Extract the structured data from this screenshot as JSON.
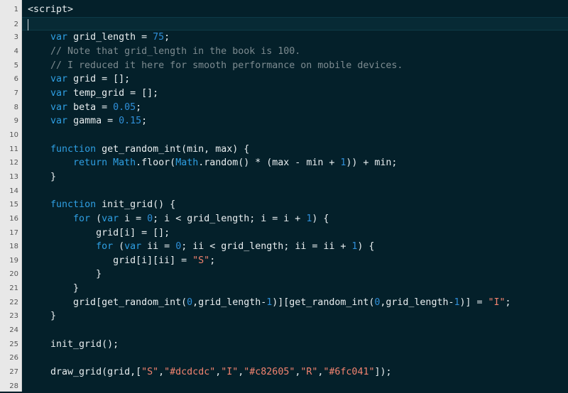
{
  "editor": {
    "active_line": 2,
    "colors": {
      "background": "#04202a",
      "keyword": "#2f9fe3",
      "number": "#2f8fd8",
      "string": "#f2836f",
      "comment": "#7d8b90",
      "plain": "#e9eef0",
      "gutter": "#e8e8e8"
    },
    "lines": [
      [
        [
          "p",
          "<script>"
        ]
      ],
      [],
      [
        [
          "p",
          "    "
        ],
        [
          "k",
          "var"
        ],
        [
          "p",
          " grid_length = "
        ],
        [
          "n",
          "75"
        ],
        [
          "p",
          ";"
        ]
      ],
      [
        [
          "c",
          "    // Note that grid_length in the book is 100."
        ]
      ],
      [
        [
          "c",
          "    // I reduced it here for smooth performance on mobile devices."
        ]
      ],
      [
        [
          "p",
          "    "
        ],
        [
          "k",
          "var"
        ],
        [
          "p",
          " grid = [];"
        ]
      ],
      [
        [
          "p",
          "    "
        ],
        [
          "k",
          "var"
        ],
        [
          "p",
          " temp_grid = [];"
        ]
      ],
      [
        [
          "p",
          "    "
        ],
        [
          "k",
          "var"
        ],
        [
          "p",
          " beta = "
        ],
        [
          "n",
          "0.05"
        ],
        [
          "p",
          ";"
        ]
      ],
      [
        [
          "p",
          "    "
        ],
        [
          "k",
          "var"
        ],
        [
          "p",
          " gamma = "
        ],
        [
          "n",
          "0.15"
        ],
        [
          "p",
          ";"
        ]
      ],
      [],
      [
        [
          "p",
          "    "
        ],
        [
          "k",
          "function"
        ],
        [
          "p",
          " get_random_int(min, max) {"
        ]
      ],
      [
        [
          "p",
          "        "
        ],
        [
          "k",
          "return"
        ],
        [
          "p",
          " "
        ],
        [
          "k",
          "Math"
        ],
        [
          "p",
          ".floor("
        ],
        [
          "k",
          "Math"
        ],
        [
          "p",
          ".random() * (max - min + "
        ],
        [
          "n",
          "1"
        ],
        [
          "p",
          ")) + min;"
        ]
      ],
      [
        [
          "p",
          "    }"
        ]
      ],
      [],
      [
        [
          "p",
          "    "
        ],
        [
          "k",
          "function"
        ],
        [
          "p",
          " init_grid() {"
        ]
      ],
      [
        [
          "p",
          "        "
        ],
        [
          "k",
          "for"
        ],
        [
          "p",
          " ("
        ],
        [
          "k",
          "var"
        ],
        [
          "p",
          " i = "
        ],
        [
          "n",
          "0"
        ],
        [
          "p",
          "; i < grid_length; i = i + "
        ],
        [
          "n",
          "1"
        ],
        [
          "p",
          ") {"
        ]
      ],
      [
        [
          "p",
          "            grid[i] = [];"
        ]
      ],
      [
        [
          "p",
          "            "
        ],
        [
          "k",
          "for"
        ],
        [
          "p",
          " ("
        ],
        [
          "k",
          "var"
        ],
        [
          "p",
          " ii = "
        ],
        [
          "n",
          "0"
        ],
        [
          "p",
          "; ii < grid_length; ii = ii + "
        ],
        [
          "n",
          "1"
        ],
        [
          "p",
          ") {"
        ]
      ],
      [
        [
          "p",
          "               grid[i][ii] = "
        ],
        [
          "s",
          "\"S\""
        ],
        [
          "p",
          ";"
        ]
      ],
      [
        [
          "p",
          "            }"
        ]
      ],
      [
        [
          "p",
          "        }"
        ]
      ],
      [
        [
          "p",
          "        grid[get_random_int("
        ],
        [
          "n",
          "0"
        ],
        [
          "p",
          ",grid_length-"
        ],
        [
          "n",
          "1"
        ],
        [
          "p",
          ")][get_random_int("
        ],
        [
          "n",
          "0"
        ],
        [
          "p",
          ",grid_length-"
        ],
        [
          "n",
          "1"
        ],
        [
          "p",
          ")] = "
        ],
        [
          "s",
          "\"I\""
        ],
        [
          "p",
          ";"
        ]
      ],
      [
        [
          "p",
          "    }"
        ]
      ],
      [],
      [
        [
          "p",
          "    init_grid();"
        ]
      ],
      [],
      [
        [
          "p",
          "    draw_grid(grid,["
        ],
        [
          "s",
          "\"S\""
        ],
        [
          "p",
          ","
        ],
        [
          "s",
          "\"#dcdcdc\""
        ],
        [
          "p",
          ","
        ],
        [
          "s",
          "\"I\""
        ],
        [
          "p",
          ","
        ],
        [
          "s",
          "\"#c82605\""
        ],
        [
          "p",
          ","
        ],
        [
          "s",
          "\"R\""
        ],
        [
          "p",
          ","
        ],
        [
          "s",
          "\"#6fc041\""
        ],
        [
          "p",
          "]);"
        ]
      ],
      []
    ]
  }
}
